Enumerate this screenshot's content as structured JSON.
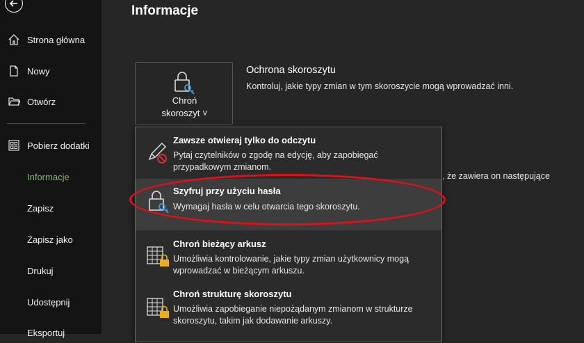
{
  "sidebar": {
    "items": [
      {
        "label": "Strona główna",
        "icon": "home-icon"
      },
      {
        "label": "Nowy",
        "icon": "new-document-icon"
      },
      {
        "label": "Otwórz",
        "icon": "open-folder-icon"
      },
      {
        "label": "Pobierz dodatki",
        "icon": "addins-grid-icon"
      },
      {
        "label": "Informacje",
        "active": true
      },
      {
        "label": "Zapisz"
      },
      {
        "label": "Zapisz jako"
      },
      {
        "label": "Drukuj"
      },
      {
        "label": "Udostępnij"
      },
      {
        "label": "Eksportuj"
      }
    ]
  },
  "main": {
    "title": "Informacje",
    "protect_button": {
      "line1": "Chroń",
      "line2": "skoroszyt ˅"
    },
    "section_title": "Ochrona skoroszytu",
    "section_desc": "Kontroluj, jakie typy zmian w tym skoroszycie mogą wprowadzać inni.",
    "partial_text": ", że zawiera on następujące"
  },
  "menu": {
    "items": [
      {
        "title": "Zawsze otwieraj tylko do odczytu",
        "desc": "Pytaj czytelników o zgodę na edycję, aby zapobiegać przypadkowym zmianom.",
        "icon": "read-only-pencil-icon"
      },
      {
        "title": "Szyfruj przy użyciu hasła",
        "desc": "Wymagaj hasła w celu otwarcia tego skoroszytu.",
        "icon": "lock-key-icon",
        "highlighted": true
      },
      {
        "title": "Chroń bieżący arkusz",
        "desc": "Umożliwia kontrolowanie, jakie typy zmian użytkownicy mogą wprowadzać w bieżącym arkuszu.",
        "icon": "sheet-lock-icon"
      },
      {
        "title": "Chroń strukturę skoroszytu",
        "desc": "Umożliwia zapobieganie niepożądanym zmianom w strukturze skoroszytu, takim jak dodawanie arkuszy.",
        "icon": "workbook-structure-lock-icon"
      }
    ]
  },
  "colors": {
    "accent_green": "#86b67a",
    "highlight_ellipse": "#e0101a"
  }
}
